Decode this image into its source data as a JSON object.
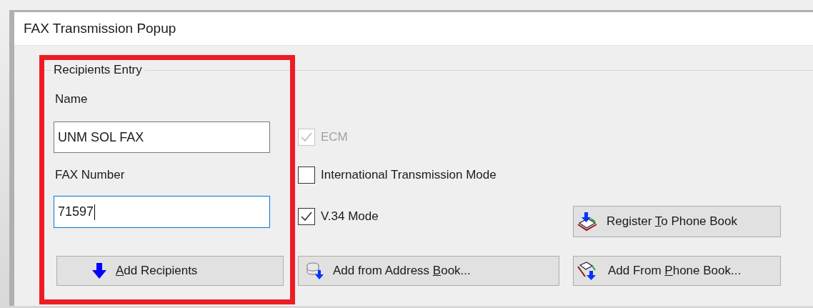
{
  "window": {
    "title": "FAX Transmission Popup"
  },
  "recipients_entry": {
    "legend": "Recipients Entry",
    "highlight": true,
    "name_label": "Name",
    "name_field": {
      "value": "UNM SOL FAX",
      "focused": false
    },
    "fax_label": "FAX Number",
    "fax_field": {
      "value": "71597",
      "focused": true
    }
  },
  "options": [
    {
      "label": "ECM",
      "checked": true,
      "disabled": true
    },
    {
      "label": "International Transmission Mode",
      "checked": false,
      "disabled": false
    },
    {
      "label": "V.34 Mode",
      "checked": true,
      "disabled": false
    }
  ],
  "buttons": [
    {
      "kind": "add_recipient",
      "label_parts": [
        {
          "text": "A",
          "underlined": true
        },
        {
          "text": "dd Recipients",
          "underlined": false
        }
      ]
    },
    {
      "kind": "address_book",
      "label_parts": [
        {
          "text": "Add from Address ",
          "underlined": false
        },
        {
          "text": "B",
          "underlined": true
        },
        {
          "text": "ook...",
          "underlined": false
        }
      ]
    },
    {
      "kind": "register_phone_book",
      "label_parts": [
        {
          "text": "Register ",
          "underlined": false
        },
        {
          "text": "T",
          "underlined": true
        },
        {
          "text": "o Phone Book",
          "underlined": false
        }
      ]
    },
    {
      "kind": "phone_book",
      "label_parts": [
        {
          "text": "Add From ",
          "underlined": false
        },
        {
          "text": "P",
          "underlined": true
        },
        {
          "text": "hone Book...",
          "underlined": false
        }
      ]
    }
  ]
}
